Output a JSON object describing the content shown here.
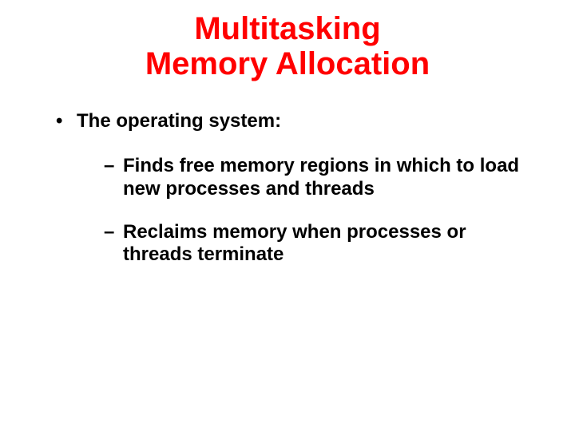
{
  "title_line1": "Multitasking",
  "title_line2": "Memory Allocation",
  "bullets": {
    "lvl1": {
      "marker": "•",
      "text": "The operating system:"
    },
    "lvl2a": {
      "marker": "–",
      "text": "Finds free memory regions in which to load new processes and threads"
    },
    "lvl2b": {
      "marker": "–",
      "text": "Reclaims memory when processes or threads terminate"
    }
  }
}
